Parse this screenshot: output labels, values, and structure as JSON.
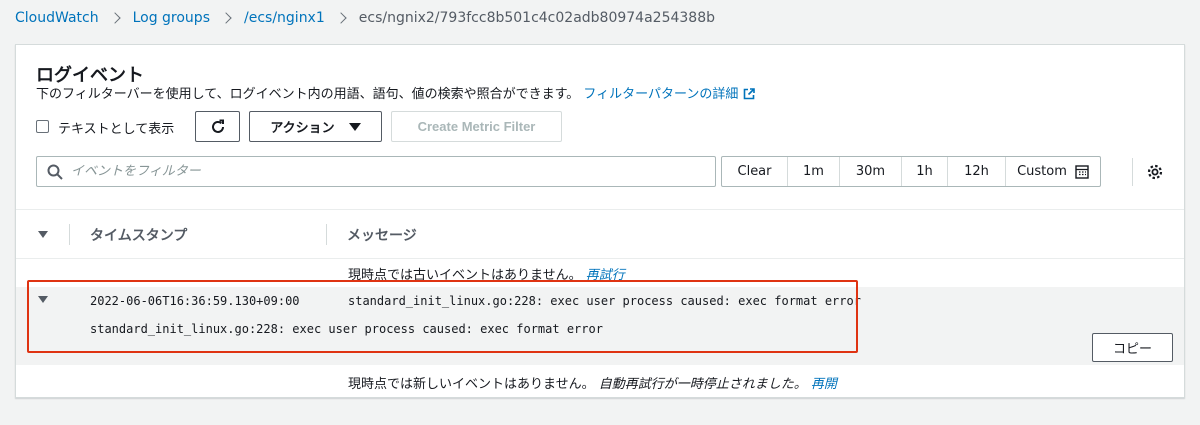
{
  "breadcrumb": {
    "items": [
      "CloudWatch",
      "Log groups",
      "/ecs/nginx1"
    ],
    "current": "ecs/ngnix2/793fcc8b501c4c02adb80974a254388b"
  },
  "header": {
    "title": "ログイベント",
    "description": "下のフィルターバーを使用して、ログイベント内の用語、語句、値の検索や照合ができます。",
    "help_link": "フィルターパターンの詳細"
  },
  "toolbar": {
    "text_view_label": "テキストとして表示",
    "actions_label": "アクション",
    "create_metric_filter_label": "Create Metric Filter"
  },
  "search": {
    "placeholder": "イベントをフィルター"
  },
  "time_range": {
    "items": [
      {
        "label": "Clear"
      },
      {
        "label": "1m"
      },
      {
        "label": "30m"
      },
      {
        "label": "1h"
      },
      {
        "label": "12h"
      },
      {
        "label": "Custom"
      }
    ]
  },
  "table": {
    "columns": [
      "タイムスタンプ",
      "メッセージ"
    ],
    "older_notice": "現時点では古いイベントはありません。",
    "retry_label": "再試行",
    "newer_notice": "現時点では新しいイベントはありません。",
    "auto_retry_notice": "自動再試行が一時停止されました。",
    "resume_label": "再開",
    "events": [
      {
        "timestamp": "2022-06-06T16:36:59.130+09:00",
        "message": "standard_init_linux.go:228: exec user process caused: exec format error",
        "detail": "standard_init_linux.go:228: exec user process caused: exec format error"
      }
    ],
    "copy_label": "コピー"
  },
  "colors": {
    "link": "#0073bb",
    "highlight_border": "#df3312",
    "expanded_row_bg": "#f2f3f3"
  }
}
